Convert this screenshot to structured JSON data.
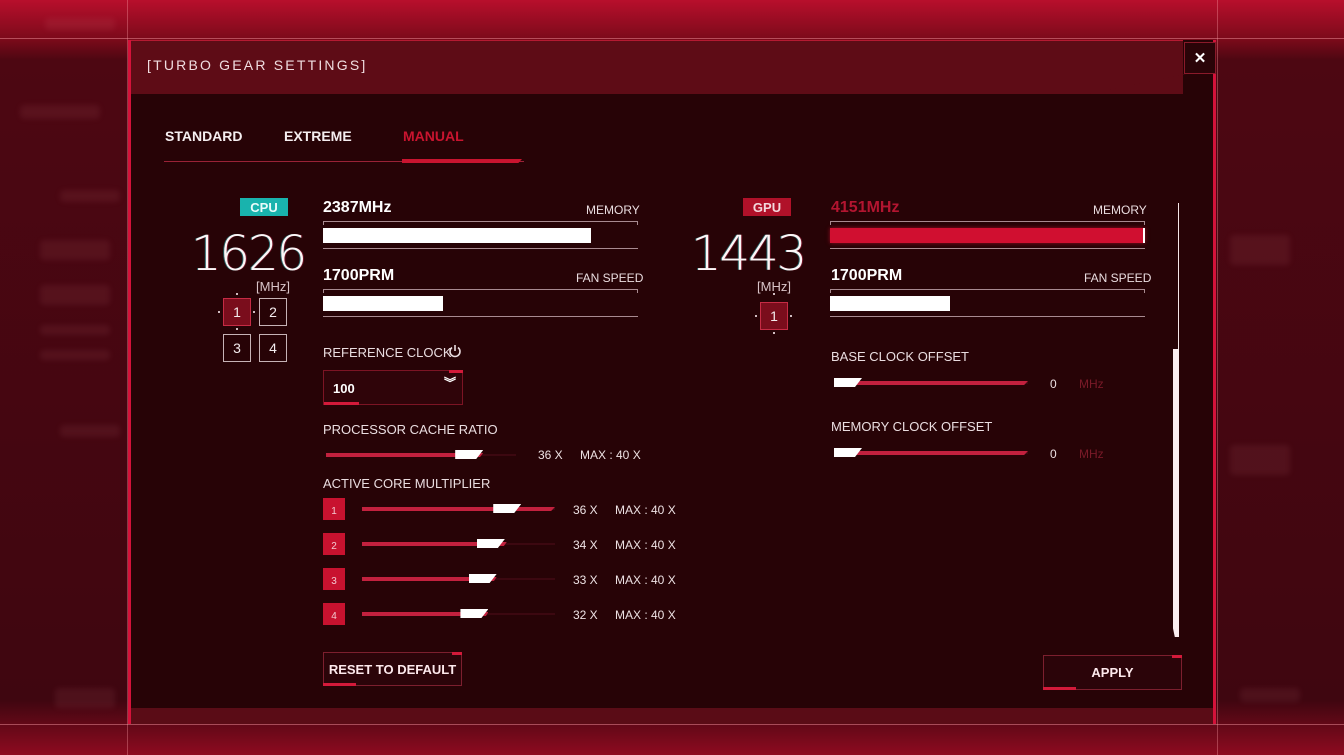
{
  "dialog": {
    "title": "[TURBO GEAR SETTINGS]",
    "close_icon": "close-icon",
    "tabs": [
      {
        "label": "STANDARD",
        "active": false
      },
      {
        "label": "EXTREME",
        "active": false
      },
      {
        "label": "MANUAL",
        "active": true
      }
    ]
  },
  "cpu": {
    "badge": "CPU",
    "frequency": "1626",
    "unit": "[MHz]",
    "cores": [
      "1",
      "2",
      "3",
      "4"
    ],
    "selected_core": "1",
    "memory": {
      "value": "2387MHz",
      "label": "MEMORY",
      "fill_percent": 85
    },
    "fan": {
      "value": "1700PRM",
      "label": "FAN SPEED",
      "fill_percent": 38
    },
    "reference_clock": {
      "label": "REFERENCE CLOCK",
      "icon": "power-icon",
      "value": "100",
      "chevron_icon": "double-chevron-down-icon"
    },
    "processor_cache_ratio": {
      "label": "PROCESSOR CACHE RATIO",
      "value": "36 X",
      "max": "MAX : 40 X",
      "value_num": 36,
      "max_num": 40
    },
    "active_core_multiplier": {
      "label": "ACTIVE CORE MULTIPLIER",
      "cores": [
        {
          "id": "1",
          "value": "36 X",
          "max": "MAX : 40 X",
          "value_num": 36,
          "limit_fraction": 1.0
        },
        {
          "id": "2",
          "value": "34 X",
          "max": "MAX : 40 X",
          "value_num": 34,
          "limit_fraction": 0.75
        },
        {
          "id": "3",
          "value": "33 X",
          "max": "MAX : 40 X",
          "value_num": 33,
          "limit_fraction": 0.6
        },
        {
          "id": "4",
          "value": "32 X",
          "max": "MAX : 40 X",
          "value_num": 32,
          "limit_fraction": 0.5
        }
      ]
    }
  },
  "gpu": {
    "badge": "GPU",
    "frequency": "1443",
    "unit": "[MHz]",
    "cores": [
      "1"
    ],
    "selected_core": "1",
    "memory": {
      "value": "4151MHz",
      "label": "MEMORY",
      "fill_percent": 100
    },
    "fan": {
      "value": "1700PRM",
      "label": "FAN SPEED",
      "fill_percent": 38
    },
    "base_clock_offset": {
      "label": "BASE CLOCK OFFSET",
      "value": "0",
      "unit": "MHz"
    },
    "memory_clock_offset": {
      "label": "MEMORY CLOCK OFFSET",
      "value": "0",
      "unit": "MHz"
    }
  },
  "buttons": {
    "reset": "RESET TO DEFAULT",
    "apply": "APPLY"
  },
  "colors": {
    "accent_red": "#c9142f",
    "cpu_teal": "#19b3ad",
    "panel_bg": "#270306"
  }
}
